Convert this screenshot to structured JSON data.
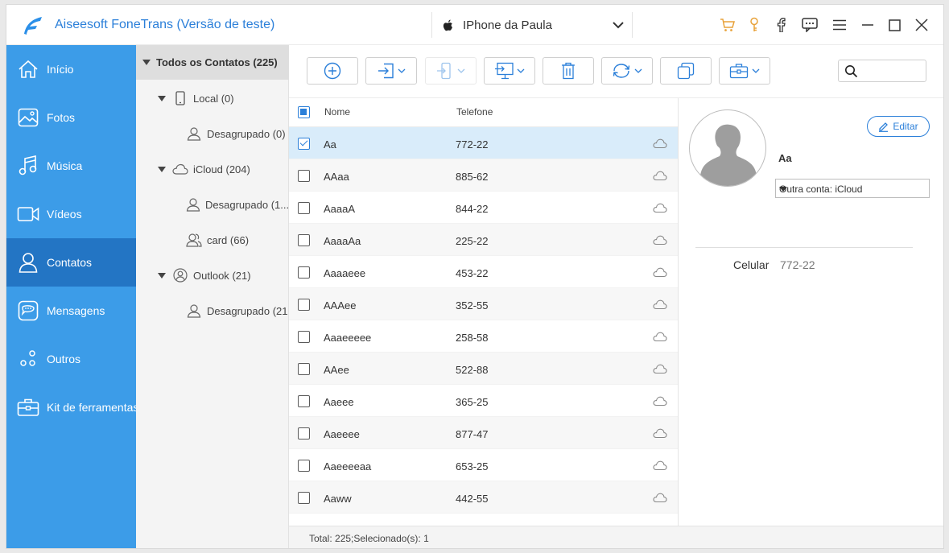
{
  "app": {
    "title": "Aiseesoft FoneTrans (Versão de teste)"
  },
  "device": {
    "name": "IPhone da Paula"
  },
  "sidebar": {
    "items": [
      {
        "label": "Início",
        "icon": "home-icon"
      },
      {
        "label": "Fotos",
        "icon": "photo-icon"
      },
      {
        "label": "Música",
        "icon": "music-icon"
      },
      {
        "label": "Vídeos",
        "icon": "video-icon"
      },
      {
        "label": "Contatos",
        "icon": "contacts-icon",
        "active": true
      },
      {
        "label": "Mensagens",
        "icon": "messages-icon"
      },
      {
        "label": "Outros",
        "icon": "others-icon"
      },
      {
        "label": "Kit de ferramentas",
        "icon": "toolbox-icon"
      }
    ]
  },
  "tree": {
    "header": "Todos os Contatos",
    "header_count": "(225)",
    "nodes": [
      {
        "label": "Local",
        "count": "(0)"
      },
      {
        "label": "Desagrupado",
        "count": "(0)"
      },
      {
        "label": "iCloud",
        "count": "(204)"
      },
      {
        "label": "Desagrupado",
        "count": "(1..."
      },
      {
        "label": "card",
        "count": "(66)"
      },
      {
        "label": "Outlook",
        "count": "(21)"
      },
      {
        "label": "Desagrupado",
        "count": "(21"
      }
    ]
  },
  "list": {
    "header_name": "Nome",
    "header_phone": "Telefone",
    "rows": [
      {
        "name": "Aa",
        "phone": "772-22",
        "selected": true
      },
      {
        "name": "AAaa",
        "phone": "885-62"
      },
      {
        "name": "AaaaA",
        "phone": "844-22"
      },
      {
        "name": "AaaaAa",
        "phone": "225-22"
      },
      {
        "name": "Aaaaeee",
        "phone": "453-22"
      },
      {
        "name": "AAAee",
        "phone": "352-55"
      },
      {
        "name": "Aaaeeeee",
        "phone": "258-58"
      },
      {
        "name": "AAee",
        "phone": "522-88"
      },
      {
        "name": "Aaeee",
        "phone": "365-25"
      },
      {
        "name": "Aaeeee",
        "phone": "877-47"
      },
      {
        "name": "Aaeeeeaa",
        "phone": "653-25"
      },
      {
        "name": "Aaww",
        "phone": "442-55"
      }
    ]
  },
  "status": {
    "text": "Total: 225;Selecionado(s): 1"
  },
  "detail": {
    "name": "Aa",
    "edit_label": "Editar",
    "account": "Outra conta: iCloud",
    "field_label": "Celular",
    "field_value": "772-22"
  },
  "colors": {
    "accent": "#2b7fd9",
    "sidebar": "#3c9ce8",
    "sidebar_active": "#2375c4",
    "cart": "#e8a23a"
  }
}
